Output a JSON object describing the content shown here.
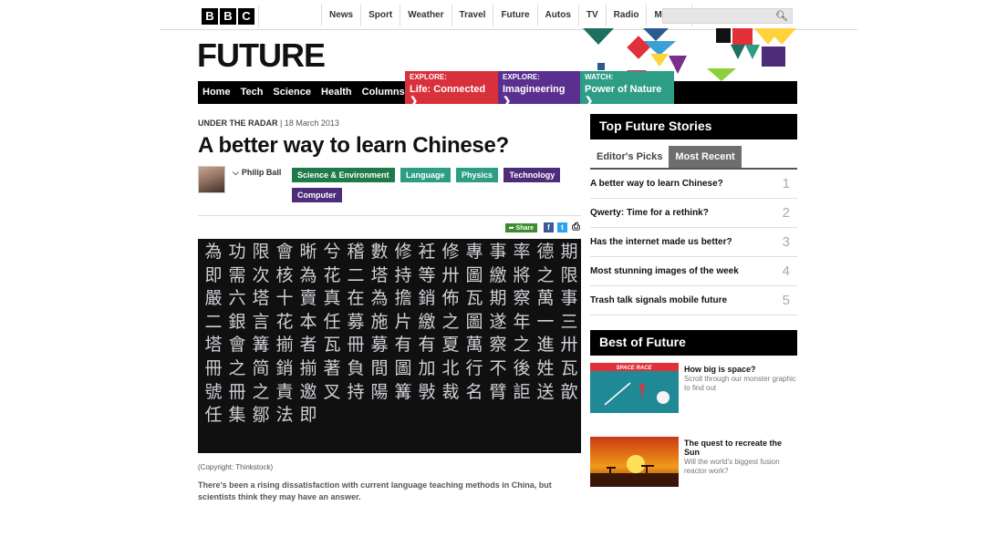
{
  "topbar": {
    "logo_letters": [
      "B",
      "B",
      "C"
    ],
    "nav": [
      "News",
      "Sport",
      "Weather",
      "Travel",
      "Future",
      "Autos",
      "TV",
      "Radio",
      "More..."
    ],
    "search_placeholder": "",
    "search_icon": "search-icon"
  },
  "header": {
    "title": "FUTURE"
  },
  "mainnav": {
    "links": [
      "Home",
      "Tech",
      "Science",
      "Health",
      "Columns"
    ],
    "promos": [
      {
        "kicker": "EXPLORE:",
        "label": "Life: Connected",
        "color": "#d9313c"
      },
      {
        "kicker": "EXPLORE:",
        "label": "Imagineering",
        "color": "#5a2f8f"
      },
      {
        "kicker": "WATCH:",
        "label": "Power of Nature",
        "color": "#2e9d86"
      }
    ]
  },
  "article": {
    "kicker_label": "UNDER THE RADAR",
    "date": "| 18 March 2013",
    "headline": "A better way to learn Chinese?",
    "author": "Philip Ball",
    "tags": [
      {
        "label": "Science & Environment",
        "color": "#1f7a4a"
      },
      {
        "label": "Language",
        "color": "#2e9d86"
      },
      {
        "label": "Physics",
        "color": "#2e9d86"
      },
      {
        "label": "Technology",
        "color": "#4d2c7a"
      },
      {
        "label": "Computer",
        "color": "#4d2c7a"
      }
    ],
    "share_label": "Share",
    "hero_characters": "為功限會晰兮稽數修衽修專事率德期即需次核為花二塔持等卅圖繳將之限嚴六塔十賣真在為擔銷佈瓦期察萬事二銀言花本任募施片繳之圖遂年一三塔會篝揃者瓦冊募有有夏萬察之進卅冊之简銷揃著負間圖加北行不後姓瓦號冊之責邀叉持陽篝斅裁名臂詎送歆任集鄒法即",
    "caption": "(Copyright: Thinkstock)",
    "summary": "There's been a rising dissatisfaction with current language teaching methods in China, but scientists think they may have an answer."
  },
  "sidebar": {
    "top_title": "Top Future Stories",
    "tabs": [
      "Editor's Picks",
      "Most Recent"
    ],
    "active_tab": "Most Recent",
    "stories": [
      {
        "title": "A better way to learn Chinese?",
        "rank": "1"
      },
      {
        "title": "Qwerty: Time for a rethink?",
        "rank": "2"
      },
      {
        "title": "Has the internet made us better?",
        "rank": "3"
      },
      {
        "title": "Most stunning images of the week",
        "rank": "4"
      },
      {
        "title": "Trash talk signals mobile future",
        "rank": "5"
      }
    ],
    "best_title": "Best of Future",
    "best": [
      {
        "title": "How big is space?",
        "desc": "Scroll through our monster graphic to find out",
        "image_text": "SPACE RACE"
      },
      {
        "title": "The quest to recreate the Sun",
        "desc": "Will the world's biggest fusion reactor work?"
      }
    ]
  }
}
